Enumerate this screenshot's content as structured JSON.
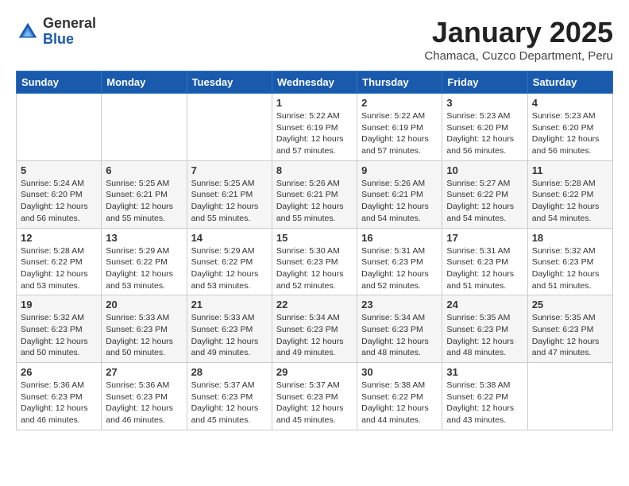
{
  "header": {
    "logo": {
      "general": "General",
      "blue": "Blue"
    },
    "title": "January 2025",
    "location": "Chamaca, Cuzco Department, Peru"
  },
  "weekdays": [
    "Sunday",
    "Monday",
    "Tuesday",
    "Wednesday",
    "Thursday",
    "Friday",
    "Saturday"
  ],
  "weeks": [
    [
      {
        "day": "",
        "info": ""
      },
      {
        "day": "",
        "info": ""
      },
      {
        "day": "",
        "info": ""
      },
      {
        "day": "1",
        "info": "Sunrise: 5:22 AM\nSunset: 6:19 PM\nDaylight: 12 hours\nand 57 minutes."
      },
      {
        "day": "2",
        "info": "Sunrise: 5:22 AM\nSunset: 6:19 PM\nDaylight: 12 hours\nand 57 minutes."
      },
      {
        "day": "3",
        "info": "Sunrise: 5:23 AM\nSunset: 6:20 PM\nDaylight: 12 hours\nand 56 minutes."
      },
      {
        "day": "4",
        "info": "Sunrise: 5:23 AM\nSunset: 6:20 PM\nDaylight: 12 hours\nand 56 minutes."
      }
    ],
    [
      {
        "day": "5",
        "info": "Sunrise: 5:24 AM\nSunset: 6:20 PM\nDaylight: 12 hours\nand 56 minutes."
      },
      {
        "day": "6",
        "info": "Sunrise: 5:25 AM\nSunset: 6:21 PM\nDaylight: 12 hours\nand 55 minutes."
      },
      {
        "day": "7",
        "info": "Sunrise: 5:25 AM\nSunset: 6:21 PM\nDaylight: 12 hours\nand 55 minutes."
      },
      {
        "day": "8",
        "info": "Sunrise: 5:26 AM\nSunset: 6:21 PM\nDaylight: 12 hours\nand 55 minutes."
      },
      {
        "day": "9",
        "info": "Sunrise: 5:26 AM\nSunset: 6:21 PM\nDaylight: 12 hours\nand 54 minutes."
      },
      {
        "day": "10",
        "info": "Sunrise: 5:27 AM\nSunset: 6:22 PM\nDaylight: 12 hours\nand 54 minutes."
      },
      {
        "day": "11",
        "info": "Sunrise: 5:28 AM\nSunset: 6:22 PM\nDaylight: 12 hours\nand 54 minutes."
      }
    ],
    [
      {
        "day": "12",
        "info": "Sunrise: 5:28 AM\nSunset: 6:22 PM\nDaylight: 12 hours\nand 53 minutes."
      },
      {
        "day": "13",
        "info": "Sunrise: 5:29 AM\nSunset: 6:22 PM\nDaylight: 12 hours\nand 53 minutes."
      },
      {
        "day": "14",
        "info": "Sunrise: 5:29 AM\nSunset: 6:22 PM\nDaylight: 12 hours\nand 53 minutes."
      },
      {
        "day": "15",
        "info": "Sunrise: 5:30 AM\nSunset: 6:23 PM\nDaylight: 12 hours\nand 52 minutes."
      },
      {
        "day": "16",
        "info": "Sunrise: 5:31 AM\nSunset: 6:23 PM\nDaylight: 12 hours\nand 52 minutes."
      },
      {
        "day": "17",
        "info": "Sunrise: 5:31 AM\nSunset: 6:23 PM\nDaylight: 12 hours\nand 51 minutes."
      },
      {
        "day": "18",
        "info": "Sunrise: 5:32 AM\nSunset: 6:23 PM\nDaylight: 12 hours\nand 51 minutes."
      }
    ],
    [
      {
        "day": "19",
        "info": "Sunrise: 5:32 AM\nSunset: 6:23 PM\nDaylight: 12 hours\nand 50 minutes."
      },
      {
        "day": "20",
        "info": "Sunrise: 5:33 AM\nSunset: 6:23 PM\nDaylight: 12 hours\nand 50 minutes."
      },
      {
        "day": "21",
        "info": "Sunrise: 5:33 AM\nSunset: 6:23 PM\nDaylight: 12 hours\nand 49 minutes."
      },
      {
        "day": "22",
        "info": "Sunrise: 5:34 AM\nSunset: 6:23 PM\nDaylight: 12 hours\nand 49 minutes."
      },
      {
        "day": "23",
        "info": "Sunrise: 5:34 AM\nSunset: 6:23 PM\nDaylight: 12 hours\nand 48 minutes."
      },
      {
        "day": "24",
        "info": "Sunrise: 5:35 AM\nSunset: 6:23 PM\nDaylight: 12 hours\nand 48 minutes."
      },
      {
        "day": "25",
        "info": "Sunrise: 5:35 AM\nSunset: 6:23 PM\nDaylight: 12 hours\nand 47 minutes."
      }
    ],
    [
      {
        "day": "26",
        "info": "Sunrise: 5:36 AM\nSunset: 6:23 PM\nDaylight: 12 hours\nand 46 minutes."
      },
      {
        "day": "27",
        "info": "Sunrise: 5:36 AM\nSunset: 6:23 PM\nDaylight: 12 hours\nand 46 minutes."
      },
      {
        "day": "28",
        "info": "Sunrise: 5:37 AM\nSunset: 6:23 PM\nDaylight: 12 hours\nand 45 minutes."
      },
      {
        "day": "29",
        "info": "Sunrise: 5:37 AM\nSunset: 6:23 PM\nDaylight: 12 hours\nand 45 minutes."
      },
      {
        "day": "30",
        "info": "Sunrise: 5:38 AM\nSunset: 6:22 PM\nDaylight: 12 hours\nand 44 minutes."
      },
      {
        "day": "31",
        "info": "Sunrise: 5:38 AM\nSunset: 6:22 PM\nDaylight: 12 hours\nand 43 minutes."
      },
      {
        "day": "",
        "info": ""
      }
    ]
  ]
}
